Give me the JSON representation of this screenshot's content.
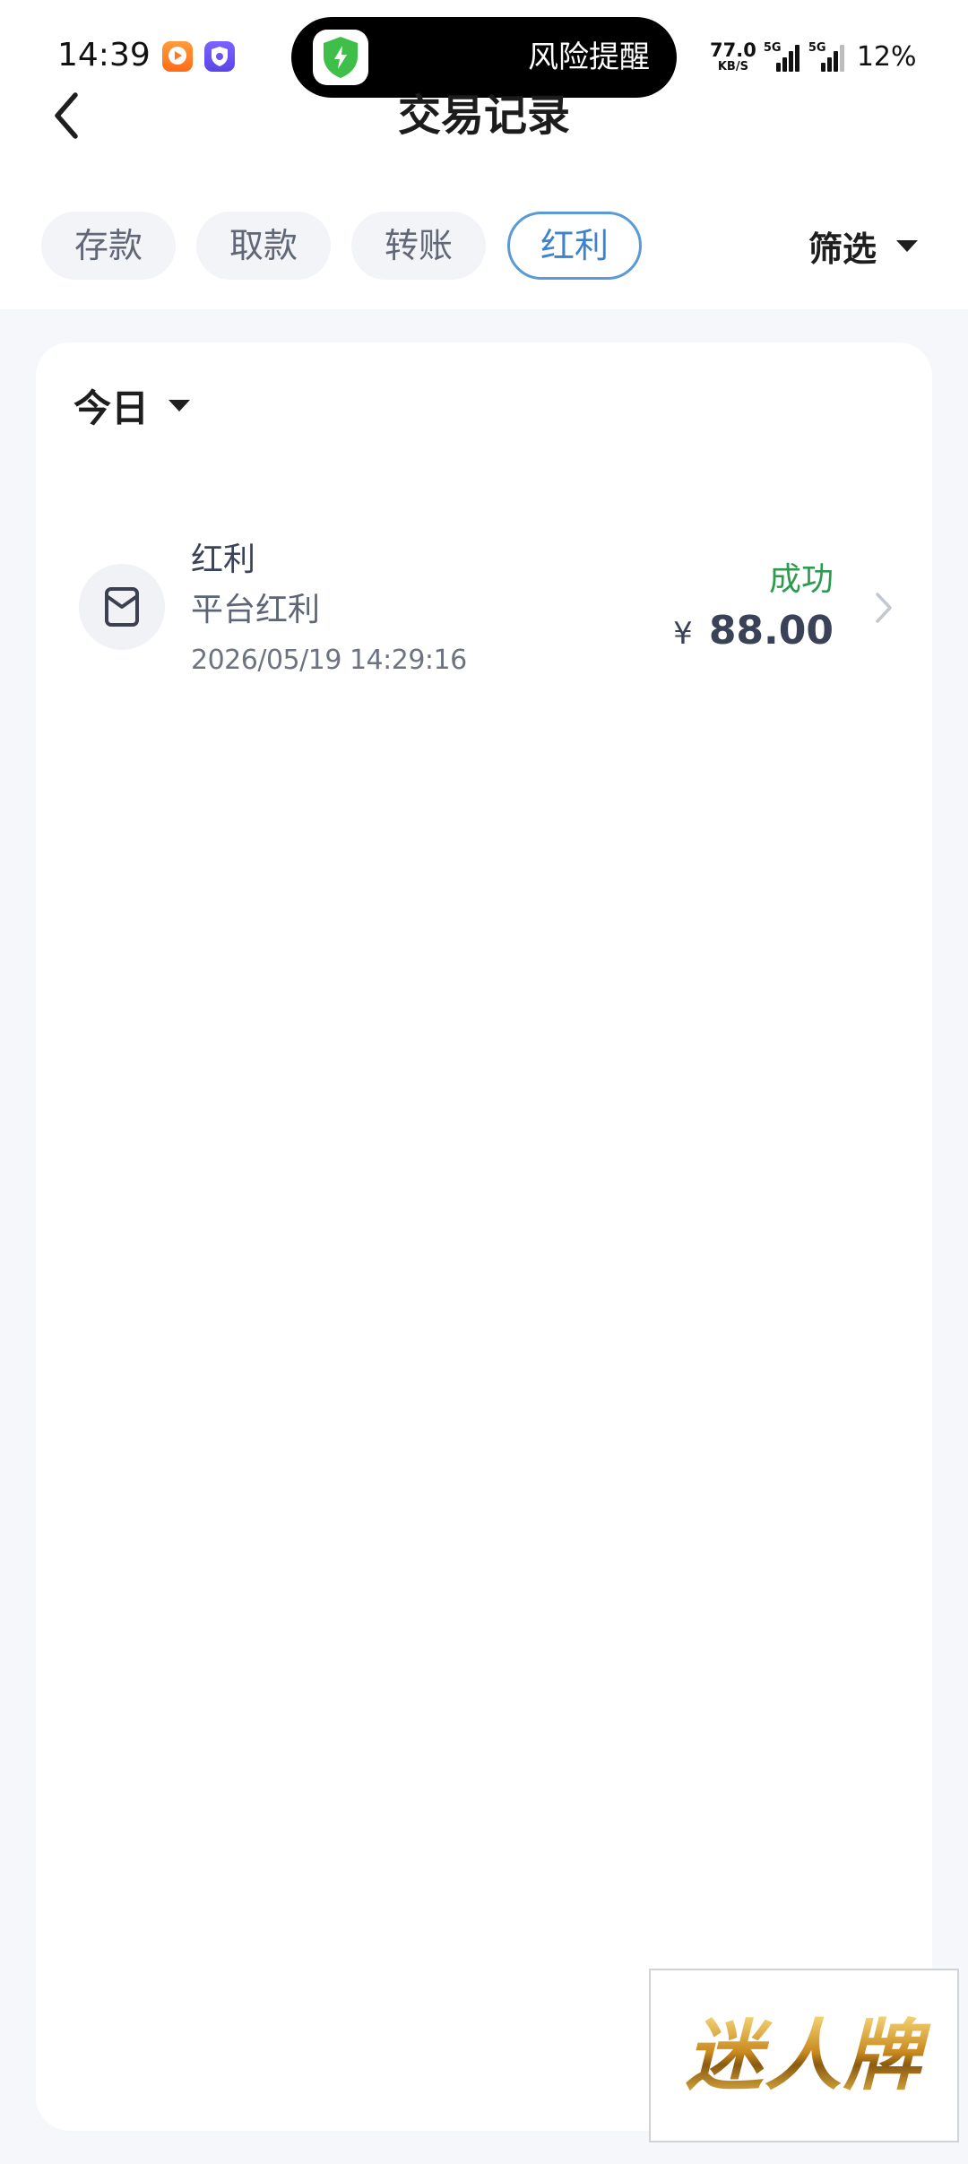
{
  "status_bar": {
    "time": "14:39",
    "net_speed_value": "77.0",
    "net_speed_unit": "KB/S",
    "signal_1_label": "5G",
    "signal_2_label": "5G",
    "battery": "12%"
  },
  "island": {
    "text": "风险提醒",
    "icon": "green-shield-bolt-icon"
  },
  "header": {
    "title": "交易记录",
    "back_icon": "chevron-left-icon"
  },
  "tabs": [
    {
      "label": "存款",
      "active": false
    },
    {
      "label": "取款",
      "active": false
    },
    {
      "label": "转账",
      "active": false
    },
    {
      "label": "红利",
      "active": true
    }
  ],
  "filter": {
    "label": "筛选"
  },
  "date_filter": {
    "label": "今日"
  },
  "records": [
    {
      "title": "红利",
      "subtitle": "平台红利",
      "time": "2026/05/19 14:29:16",
      "status": "成功",
      "currency": "¥",
      "amount": "88.00",
      "icon": "wallet-icon"
    }
  ],
  "watermark": {
    "text": "迷人牌"
  },
  "colors": {
    "accent_blue": "#3d82cc",
    "tab_border": "#5b9ad6",
    "success_green": "#2d9b4f",
    "page_background": "#f5f7fb"
  }
}
